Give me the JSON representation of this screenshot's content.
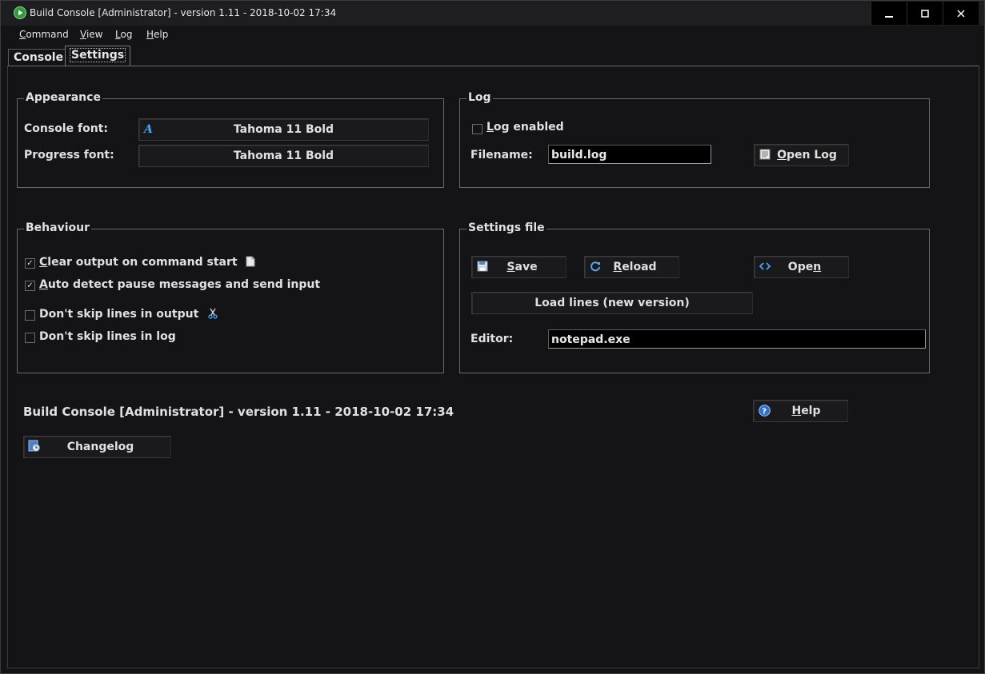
{
  "window": {
    "title": "Build Console [Administrator] - version 1.11 - 2018-10-02 17:34",
    "controls": {
      "minimize": "–",
      "maximize": "☐",
      "close": "✕"
    }
  },
  "menu": [
    {
      "label": "Command",
      "mnemonic": "C",
      "rest": "ommand"
    },
    {
      "label": "View",
      "mnemonic": "V",
      "rest": "iew"
    },
    {
      "label": "Log",
      "mnemonic": "L",
      "rest": "og"
    },
    {
      "label": "Help",
      "mnemonic": "H",
      "rest": "elp"
    }
  ],
  "tabs": [
    {
      "label": "Console",
      "active": false
    },
    {
      "label": "Settings",
      "active": true
    }
  ],
  "appearance": {
    "title": "Appearance",
    "console_font_label": "Console font:",
    "console_font_value": "Tahoma 11 Bold",
    "progress_font_label": "Progress font:",
    "progress_font_value": "Tahoma 11 Bold",
    "font_icon": "font-icon"
  },
  "log": {
    "title": "Log",
    "enabled_label_mn": "L",
    "enabled_label_rest": "og enabled",
    "enabled": false,
    "filename_label": "Filename:",
    "filename_value": "build.log",
    "open_log_mn": "O",
    "open_log_rest": "pen Log",
    "open_log_icon": "notepad-icon"
  },
  "behaviour": {
    "title": "Behaviour",
    "options": [
      {
        "mn": "C",
        "rest": "lear output on command start",
        "checked": true,
        "icon": "document-icon"
      },
      {
        "mn": "A",
        "rest": "uto detect pause messages and send input",
        "checked": true,
        "icon": ""
      },
      {
        "mn": "",
        "rest": "Don't skip lines in output",
        "checked": false,
        "icon": "scissors-icon"
      },
      {
        "mn": "",
        "rest": "Don't skip lines in log",
        "checked": false,
        "icon": ""
      }
    ]
  },
  "settings_file": {
    "title": "Settings file",
    "save_mn": "S",
    "save_rest": "ave",
    "save_icon": "floppy-icon",
    "reload_mn": "R",
    "reload_rest": "eload",
    "reload_icon": "refresh-icon",
    "open_pre": "Ope",
    "open_mn": "n",
    "open_icon": "code-icon",
    "load_lines": "Load lines (new version)",
    "editor_label": "Editor:",
    "editor_value": "notepad.exe"
  },
  "footer": {
    "version_text": "Build Console [Administrator] - version 1.11 - 2018-10-02 17:34",
    "help_mn": "H",
    "help_rest": "elp",
    "help_icon": "help-icon",
    "changelog": "Changelog",
    "changelog_icon": "changelog-icon"
  }
}
